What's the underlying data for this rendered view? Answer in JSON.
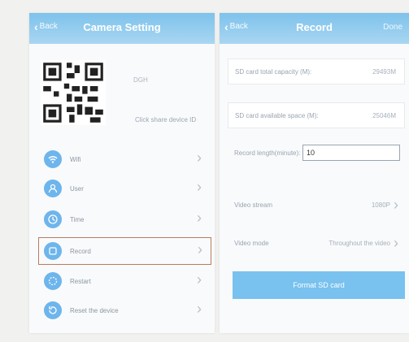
{
  "camera_setting": {
    "back_label": "Back",
    "title": "Camera Setting",
    "device_id": "DGH",
    "share_text": "Click share device ID",
    "menu": [
      {
        "label": "Wifi",
        "icon": "wifi-icon"
      },
      {
        "label": "User",
        "icon": "user-icon"
      },
      {
        "label": "Time",
        "icon": "clock-icon"
      },
      {
        "label": "Record",
        "icon": "record-icon",
        "selected": true
      },
      {
        "label": "Restart",
        "icon": "restart-icon"
      },
      {
        "label": "Reset the device",
        "icon": "reset-icon"
      }
    ]
  },
  "record": {
    "back_label": "Back",
    "title": "Record",
    "done_label": "Done",
    "sd_total_label": "SD card total capacity (M):",
    "sd_total_value": "29493M",
    "sd_available_label": "SD card available space (M):",
    "sd_available_value": "25046M",
    "record_length_label": "Record length(minute):",
    "record_length_value": "10",
    "video_stream_label": "Video stream",
    "video_stream_value": "1080P",
    "video_mode_label": "Video mode",
    "video_mode_value": "Throughout the video",
    "format_button": "Format SD card"
  },
  "colors": {
    "header_top": "#7ec2ec",
    "accent_blue": "#6db5ec",
    "selected_border": "#b87c5e"
  }
}
